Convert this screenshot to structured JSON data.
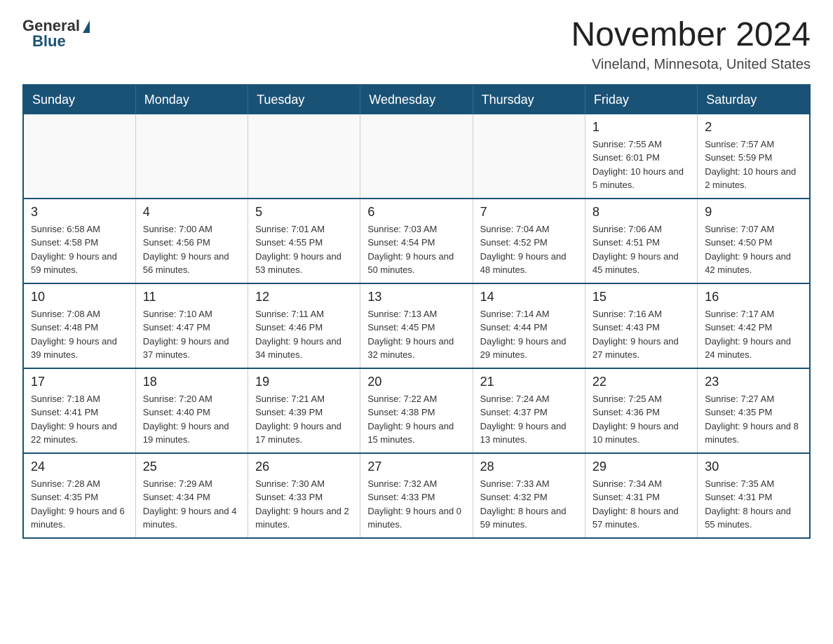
{
  "logo": {
    "general": "General",
    "blue": "Blue"
  },
  "title": "November 2024",
  "location": "Vineland, Minnesota, United States",
  "weekdays": [
    "Sunday",
    "Monday",
    "Tuesday",
    "Wednesday",
    "Thursday",
    "Friday",
    "Saturday"
  ],
  "weeks": [
    [
      {
        "day": "",
        "info": ""
      },
      {
        "day": "",
        "info": ""
      },
      {
        "day": "",
        "info": ""
      },
      {
        "day": "",
        "info": ""
      },
      {
        "day": "",
        "info": ""
      },
      {
        "day": "1",
        "info": "Sunrise: 7:55 AM\nSunset: 6:01 PM\nDaylight: 10 hours and 5 minutes."
      },
      {
        "day": "2",
        "info": "Sunrise: 7:57 AM\nSunset: 5:59 PM\nDaylight: 10 hours and 2 minutes."
      }
    ],
    [
      {
        "day": "3",
        "info": "Sunrise: 6:58 AM\nSunset: 4:58 PM\nDaylight: 9 hours and 59 minutes."
      },
      {
        "day": "4",
        "info": "Sunrise: 7:00 AM\nSunset: 4:56 PM\nDaylight: 9 hours and 56 minutes."
      },
      {
        "day": "5",
        "info": "Sunrise: 7:01 AM\nSunset: 4:55 PM\nDaylight: 9 hours and 53 minutes."
      },
      {
        "day": "6",
        "info": "Sunrise: 7:03 AM\nSunset: 4:54 PM\nDaylight: 9 hours and 50 minutes."
      },
      {
        "day": "7",
        "info": "Sunrise: 7:04 AM\nSunset: 4:52 PM\nDaylight: 9 hours and 48 minutes."
      },
      {
        "day": "8",
        "info": "Sunrise: 7:06 AM\nSunset: 4:51 PM\nDaylight: 9 hours and 45 minutes."
      },
      {
        "day": "9",
        "info": "Sunrise: 7:07 AM\nSunset: 4:50 PM\nDaylight: 9 hours and 42 minutes."
      }
    ],
    [
      {
        "day": "10",
        "info": "Sunrise: 7:08 AM\nSunset: 4:48 PM\nDaylight: 9 hours and 39 minutes."
      },
      {
        "day": "11",
        "info": "Sunrise: 7:10 AM\nSunset: 4:47 PM\nDaylight: 9 hours and 37 minutes."
      },
      {
        "day": "12",
        "info": "Sunrise: 7:11 AM\nSunset: 4:46 PM\nDaylight: 9 hours and 34 minutes."
      },
      {
        "day": "13",
        "info": "Sunrise: 7:13 AM\nSunset: 4:45 PM\nDaylight: 9 hours and 32 minutes."
      },
      {
        "day": "14",
        "info": "Sunrise: 7:14 AM\nSunset: 4:44 PM\nDaylight: 9 hours and 29 minutes."
      },
      {
        "day": "15",
        "info": "Sunrise: 7:16 AM\nSunset: 4:43 PM\nDaylight: 9 hours and 27 minutes."
      },
      {
        "day": "16",
        "info": "Sunrise: 7:17 AM\nSunset: 4:42 PM\nDaylight: 9 hours and 24 minutes."
      }
    ],
    [
      {
        "day": "17",
        "info": "Sunrise: 7:18 AM\nSunset: 4:41 PM\nDaylight: 9 hours and 22 minutes."
      },
      {
        "day": "18",
        "info": "Sunrise: 7:20 AM\nSunset: 4:40 PM\nDaylight: 9 hours and 19 minutes."
      },
      {
        "day": "19",
        "info": "Sunrise: 7:21 AM\nSunset: 4:39 PM\nDaylight: 9 hours and 17 minutes."
      },
      {
        "day": "20",
        "info": "Sunrise: 7:22 AM\nSunset: 4:38 PM\nDaylight: 9 hours and 15 minutes."
      },
      {
        "day": "21",
        "info": "Sunrise: 7:24 AM\nSunset: 4:37 PM\nDaylight: 9 hours and 13 minutes."
      },
      {
        "day": "22",
        "info": "Sunrise: 7:25 AM\nSunset: 4:36 PM\nDaylight: 9 hours and 10 minutes."
      },
      {
        "day": "23",
        "info": "Sunrise: 7:27 AM\nSunset: 4:35 PM\nDaylight: 9 hours and 8 minutes."
      }
    ],
    [
      {
        "day": "24",
        "info": "Sunrise: 7:28 AM\nSunset: 4:35 PM\nDaylight: 9 hours and 6 minutes."
      },
      {
        "day": "25",
        "info": "Sunrise: 7:29 AM\nSunset: 4:34 PM\nDaylight: 9 hours and 4 minutes."
      },
      {
        "day": "26",
        "info": "Sunrise: 7:30 AM\nSunset: 4:33 PM\nDaylight: 9 hours and 2 minutes."
      },
      {
        "day": "27",
        "info": "Sunrise: 7:32 AM\nSunset: 4:33 PM\nDaylight: 9 hours and 0 minutes."
      },
      {
        "day": "28",
        "info": "Sunrise: 7:33 AM\nSunset: 4:32 PM\nDaylight: 8 hours and 59 minutes."
      },
      {
        "day": "29",
        "info": "Sunrise: 7:34 AM\nSunset: 4:31 PM\nDaylight: 8 hours and 57 minutes."
      },
      {
        "day": "30",
        "info": "Sunrise: 7:35 AM\nSunset: 4:31 PM\nDaylight: 8 hours and 55 minutes."
      }
    ]
  ]
}
